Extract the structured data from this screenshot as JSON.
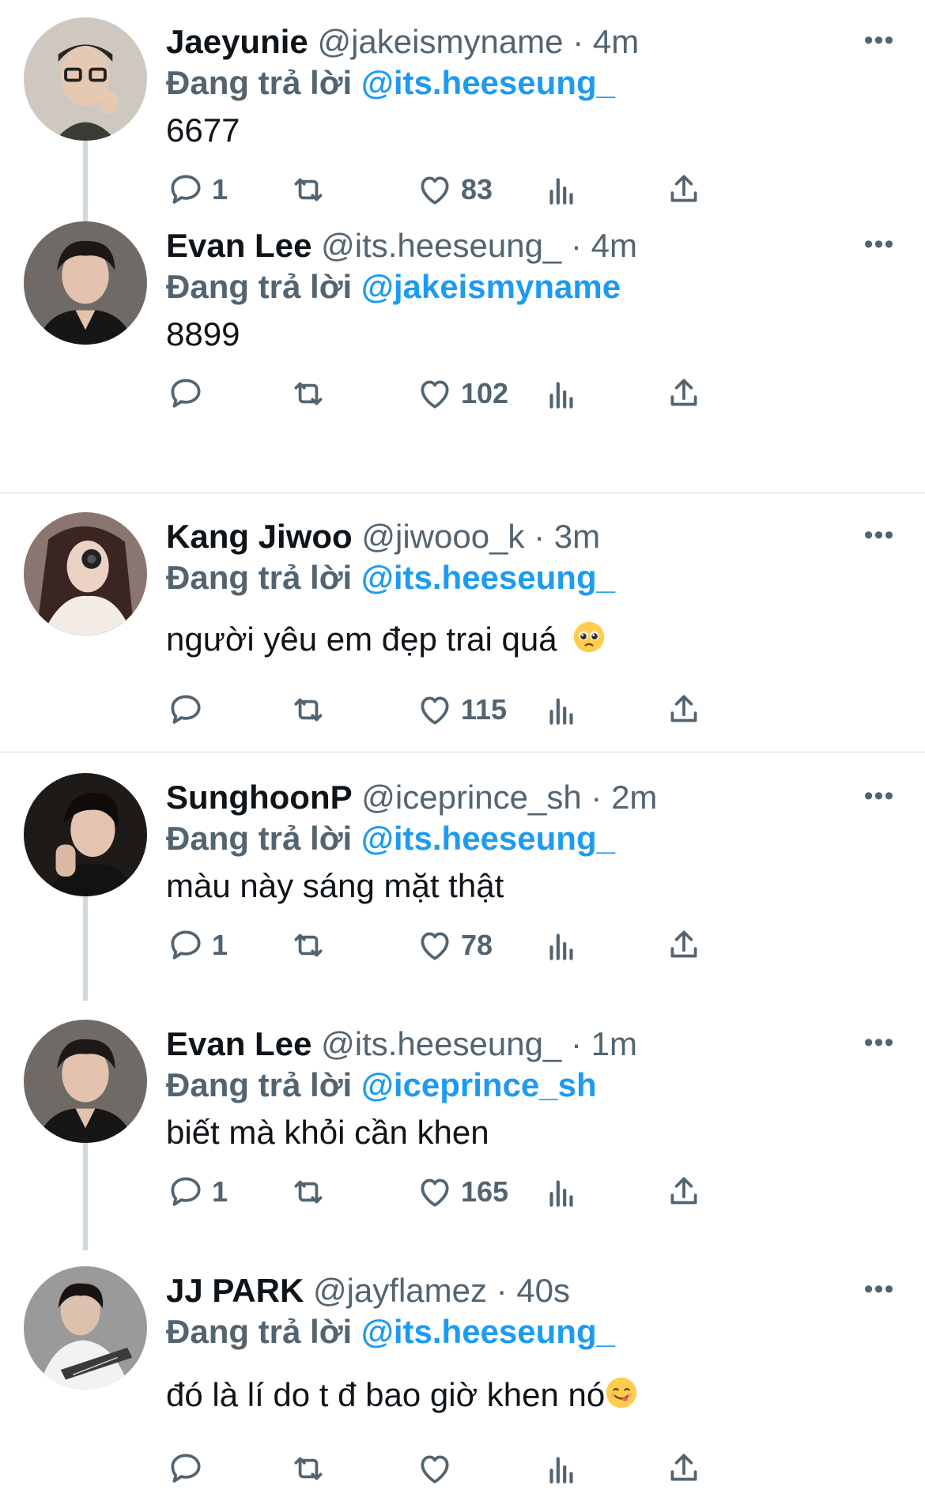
{
  "replying_prefix": "Đang trả lời",
  "more_label": "•••",
  "tweets": [
    {
      "name": "Jaeyunie",
      "handle": "@jakeismyname",
      "dot": "·",
      "time": "4m",
      "reply_to": "@its.heeseung_",
      "text": "6677",
      "reply_count": "1",
      "like_count": "83"
    },
    {
      "name": "Evan Lee",
      "handle": "@its.heeseung_",
      "dot": "·",
      "time": "4m",
      "reply_to": "@jakeismyname",
      "text": "8899",
      "reply_count": "",
      "like_count": "102"
    },
    {
      "name": "Kang Jiwoo",
      "handle": "@jiwooo_k",
      "dot": "·",
      "time": "3m",
      "reply_to": "@its.heeseung_",
      "text": "người yêu em đẹp trai quá",
      "emoji": "pleading-face-emoji",
      "reply_count": "",
      "like_count": "115"
    },
    {
      "name": "SunghoonP",
      "handle": "@iceprince_sh",
      "dot": "·",
      "time": "2m",
      "reply_to": "@its.heeseung_",
      "text": "màu này sáng mặt thật",
      "reply_count": "1",
      "like_count": "78"
    },
    {
      "name": "Evan Lee",
      "handle": "@its.heeseung_",
      "dot": "·",
      "time": "1m",
      "reply_to": "@iceprince_sh",
      "text": "biết mà khỏi cần khen",
      "reply_count": "1",
      "like_count": "165"
    },
    {
      "name": "JJ PARK",
      "handle": "@jayflamez",
      "dot": "·",
      "time": "40s",
      "reply_to": "@its.heeseung_",
      "text": "đó là lí do t đ bao giờ khen nó",
      "emoji": "yum-face-emoji",
      "reply_count": "",
      "like_count": ""
    }
  ],
  "colors": {
    "accent": "#1d9bf0",
    "secondary_text": "#536471",
    "primary_text": "#0f1419",
    "thread_line": "#cfd9de",
    "divider": "#eff3f4"
  },
  "icons": {
    "reply": "reply-bubble-icon",
    "retweet": "retweet-icon",
    "like": "heart-icon",
    "views": "views-chart-icon",
    "share": "share-icon",
    "more": "more-options-icon"
  }
}
